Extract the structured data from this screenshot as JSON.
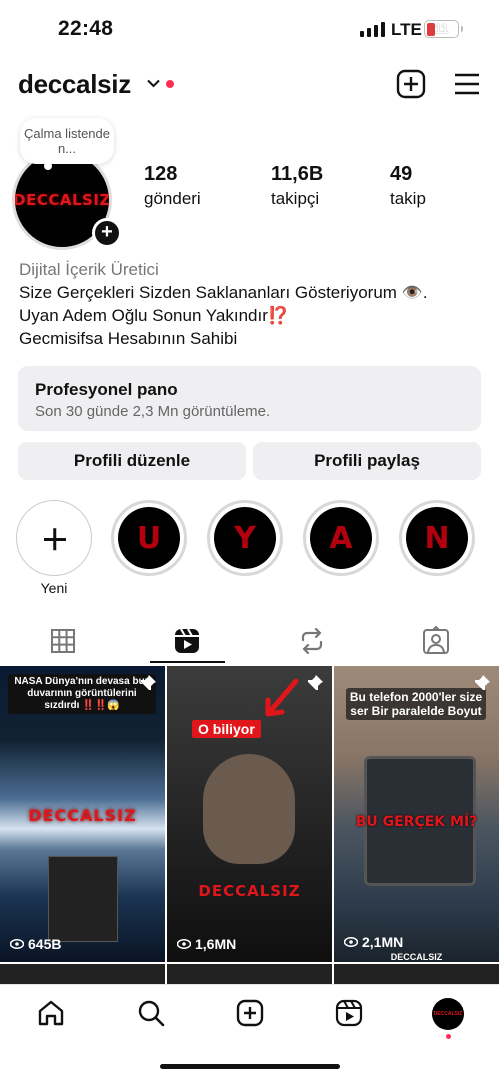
{
  "status_bar": {
    "time": "22:48",
    "network": "LTE",
    "battery": "11"
  },
  "header": {
    "username": "deccalsiz",
    "icons": [
      "chevron-down-icon",
      "new-post-icon",
      "menu-icon"
    ]
  },
  "note": {
    "text": "Çalma listende n..."
  },
  "avatar": {
    "logo_text": "DECCALSIZ"
  },
  "stats": [
    {
      "value": "128",
      "label": "gönderi"
    },
    {
      "value": "11,6B",
      "label": "takipçi"
    },
    {
      "value": "49",
      "label": "takip"
    }
  ],
  "bio": {
    "category": "Dijital İçerik Üretici",
    "line1": "Size Gerçekleri Sizden Saklananları Gösteriyorum 👁️.",
    "line2": "Uyan Adem Oğlu Sonun Yakındır⁉️",
    "line3": "Gecmisifsa Hesabının Sahibi"
  },
  "dashboard": {
    "title": "Profesyonel pano",
    "subtitle": "Son 30 günde 2,3 Mn görüntüleme."
  },
  "buttons": {
    "edit": "Profili düzenle",
    "share": "Profili paylaş"
  },
  "highlights": {
    "new_label": "Yeni",
    "items": [
      {
        "letter": "U"
      },
      {
        "letter": "Y"
      },
      {
        "letter": "A"
      },
      {
        "letter": "N"
      }
    ]
  },
  "tabs": [
    "grid-icon",
    "reels-icon",
    "reposts-icon",
    "tagged-icon"
  ],
  "posts": [
    {
      "caption": "NASA Dünya'nın devasa buz duvarının görüntülerini sızdırdı ‼️‼️😱",
      "overlay": "DECCALSIZ",
      "views": "645B",
      "pinned": true
    },
    {
      "caption": "O biliyor",
      "overlay": "DECCALSIZ",
      "views": "1,6MN",
      "pinned": true
    },
    {
      "caption": "Bu telefon 2000'ler size ser Bir paralelde Boyut",
      "overlay": "BU GERÇEK Mİ?",
      "views": "2,1MN",
      "pinned": true,
      "footer": "DECCALSIZ"
    }
  ],
  "bottom_nav": [
    "home-icon",
    "search-icon",
    "create-icon",
    "reels-icon",
    "profile-avatar"
  ],
  "colors": {
    "accent_red": "#ff2d55",
    "logo_red": "#e0161a",
    "button_bg": "#efeff2"
  }
}
